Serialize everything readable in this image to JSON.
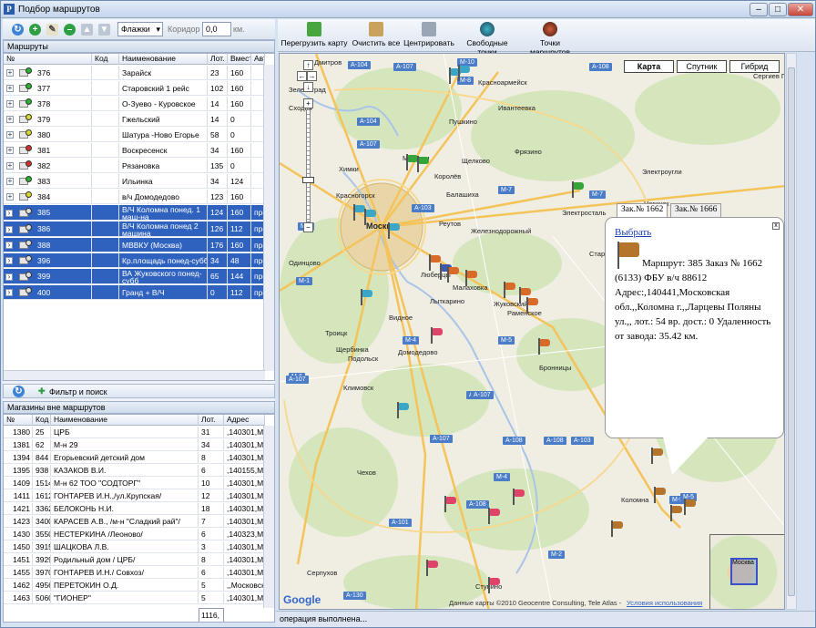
{
  "window": {
    "title": "Подбор маршрутов",
    "minimize": "–",
    "maximize": "□",
    "close": "✕"
  },
  "left_toolbar": {
    "layer_select": "Флажки",
    "corridor_label": "Коридор",
    "corridor_value": "0,0",
    "corridor_unit": "км."
  },
  "routes": {
    "panel_title": "Маршруты",
    "columns": [
      "№",
      "Код",
      "Наименование",
      "Лот.",
      "Вмест.",
      "Авто т"
    ],
    "rows": [
      {
        "num": "376",
        "name": "Зарайск",
        "lot": "23",
        "cap": "160",
        "auto": "",
        "color": "#28b42a",
        "selected": false
      },
      {
        "num": "377",
        "name": "Старовский 1 рейс",
        "lot": "102",
        "cap": "160",
        "auto": "",
        "color": "#28b42a",
        "selected": false
      },
      {
        "num": "378",
        "name": "О-Зуево - Куровское",
        "lot": "14",
        "cap": "160",
        "auto": "",
        "color": "#28b42a",
        "selected": false
      },
      {
        "num": "379",
        "name": "Гжельский",
        "lot": "14",
        "cap": "0",
        "auto": "",
        "color": "#d8d82a",
        "selected": false
      },
      {
        "num": "380",
        "name": "Шатура -Ново Егорье",
        "lot": "58",
        "cap": "0",
        "auto": "",
        "color": "#d8d82a",
        "selected": false
      },
      {
        "num": "381",
        "name": "Воскресенск",
        "lot": "34",
        "cap": "160",
        "auto": "",
        "color": "#d23030",
        "selected": false
      },
      {
        "num": "382",
        "name": "Рязановка",
        "lot": "135",
        "cap": "0",
        "auto": "",
        "color": "#d23030",
        "selected": false
      },
      {
        "num": "383",
        "name": "Ильинка",
        "lot": "34",
        "cap": "124",
        "auto": "",
        "color": "#28b42a",
        "selected": false
      },
      {
        "num": "384",
        "name": "в/ч Домодедово",
        "lot": "123",
        "cap": "160",
        "auto": "",
        "color": "#d8d82a",
        "selected": false
      },
      {
        "num": "385",
        "name": "В/Ч Коломна понед. 1 маш-на",
        "lot": "124",
        "cap": "160",
        "auto": "проста",
        "color": "#dddddd",
        "selected": true
      },
      {
        "num": "386",
        "name": "В/Ч Коломна понед 2 машина",
        "lot": "126",
        "cap": "112",
        "auto": "проста",
        "color": "#dddddd",
        "selected": true
      },
      {
        "num": "388",
        "name": "МВВКУ (Москва)",
        "lot": "176",
        "cap": "160",
        "auto": "проста",
        "color": "#dddddd",
        "selected": true
      },
      {
        "num": "396",
        "name": "Кр.площадь понед-субб",
        "lot": "34",
        "cap": "48",
        "auto": "проста",
        "color": "#dddddd",
        "selected": true
      },
      {
        "num": "399",
        "name": "ВА Жуковского понед-субб",
        "lot": "65",
        "cap": "144",
        "auto": "проста",
        "color": "#dddddd",
        "selected": true
      },
      {
        "num": "400",
        "name": "Гранд + В/Ч",
        "lot": "0",
        "cap": "112",
        "auto": "проста",
        "color": "#dddddd",
        "selected": true
      }
    ]
  },
  "filter_toolbar": {
    "label": "Фильтр и поиск"
  },
  "shops": {
    "panel_title": "Магазины вне маршрутов",
    "columns": [
      "№",
      "Код",
      "Наименование",
      "Лот.",
      "Адрес"
    ],
    "rows": [
      {
        "num": "1380",
        "code": "25",
        "name": "ЦРБ",
        "lot": "31",
        "addr": ",140301,Мос"
      },
      {
        "num": "1381",
        "code": "62",
        "name": "М-н  29",
        "lot": "34",
        "addr": ",140301,Мос"
      },
      {
        "num": "1394",
        "code": "844",
        "name": "Егорьевский детский дом",
        "lot": "8",
        "addr": ",140301,Мос"
      },
      {
        "num": "1395",
        "code": "938",
        "name": "КАЗАКОВ В.И.",
        "lot": "6",
        "addr": ",140155,Мос"
      },
      {
        "num": "1409",
        "code": "1514",
        "name": "М-н  62 ТОО \"СОДТОРГ\"",
        "lot": "10",
        "addr": ",140301,Мос"
      },
      {
        "num": "1411",
        "code": "1612",
        "name": "ГОНТАРЕВ И.Н.,/ул.Крупская/",
        "lot": "12",
        "addr": ",140301,Мос"
      },
      {
        "num": "1421",
        "code": "3362",
        "name": "БЕЛОКОНЬ Н.И.",
        "lot": "18",
        "addr": ",140301,Мос"
      },
      {
        "num": "1423",
        "code": "3400",
        "name": "КАРАСЕВ А.В.,  /м-н \"Сладкий рай\"/",
        "lot": "7",
        "addr": ",140301,Мос"
      },
      {
        "num": "1430",
        "code": "3550",
        "name": "НЕСТЕРКИНА /Леоново/",
        "lot": "6",
        "addr": ",140323,Мос"
      },
      {
        "num": "1450",
        "code": "3915",
        "name": "ШАЦКОВА Л.В.",
        "lot": "3",
        "addr": ",140301,Мос"
      },
      {
        "num": "1451",
        "code": "3929",
        "name": "Родильный дом / ЦРБ/",
        "lot": "8",
        "addr": ",140301,Мос"
      },
      {
        "num": "1455",
        "code": "3970",
        "name": "ГОНТАРЕВ И.Н./ Совхоз/",
        "lot": "6",
        "addr": ",140301,Мос"
      },
      {
        "num": "1462",
        "code": "4956",
        "name": "ПЕРЕТОКИН О.Д.",
        "lot": "5",
        "addr": ",,Московска"
      },
      {
        "num": "1463",
        "code": "5060",
        "name": "\"ГИОНЕР\"",
        "lot": "5",
        "addr": ",140301,Мос"
      }
    ],
    "total": "1116,"
  },
  "map_toolbar": {
    "reload": "Перегрузить карту",
    "clear": "Очистить все",
    "center": "Центрировать",
    "free_points": "Свободные точки",
    "route_points": "Точки маршрутов"
  },
  "map_types": {
    "map": "Карта",
    "satellite": "Спутник",
    "hybrid": "Гибрид"
  },
  "map": {
    "roads": [
      "A-104",
      "A-107",
      "M-8",
      "M-10",
      "A-104",
      "A-107",
      "A-103",
      "M-7",
      "M-7",
      "M-9",
      "M-1",
      "M-4",
      "M-5",
      "M-6",
      "A-107",
      "A-108",
      "A-107",
      "A-108",
      "A-108",
      "A-107",
      "M-5",
      "M-4",
      "A-108",
      "M-5",
      "M-2",
      "A-130",
      "A-101",
      "M-5",
      "A-103",
      "A-108"
    ],
    "towns": [
      "Красноармейск",
      "Сергиев Посад",
      "Хотьково",
      "Пушкино",
      "Ивантеевка",
      "Щелково",
      "Фрязино",
      "Мытищи",
      "Королёв",
      "Химки",
      "Балашиха",
      "Электросталь",
      "Ногинск",
      "Красногорск",
      "Москва",
      "Реутов",
      "Железнодорожный",
      "Одинцово",
      "Люберцы",
      "Лыткарино",
      "Раменское",
      "Жуковский",
      "Видное",
      "Домодедово",
      "Подольск",
      "Климовск",
      "Бронницы",
      "Чехов",
      "Ступино",
      "Коломна",
      "Серпухов",
      "Троицк",
      "Павловский Посад",
      "Старая Купавна",
      "Электроугли",
      "Дмитров",
      "Сходня",
      "Зеленоград",
      "Малаховка",
      "Щербинка"
    ]
  },
  "info_window": {
    "tab1": "Зак.№ 1662",
    "tab2": "Зак.№ 1666",
    "close": "x",
    "select_link": "Выбрать",
    "text": "Маршрут: 385 Заказ № 1662 (6133) ФБУ в/ч 88612 Адрес:,140441,Московская обл.,,Коломна г.,,Ларцевы Поляны ул.,, лот.: 54 вр. дост.: 0 Удаленность от завода: 35.42 км."
  },
  "map_footer": {
    "copyright": "Данные карты ©2010 Geocentre Consulting, Tele Atlas -",
    "terms": "Условия использования",
    "logo": "Google"
  },
  "minimap": {
    "label": "Москва"
  },
  "status_bar": {
    "text": "операция выполнена..."
  }
}
